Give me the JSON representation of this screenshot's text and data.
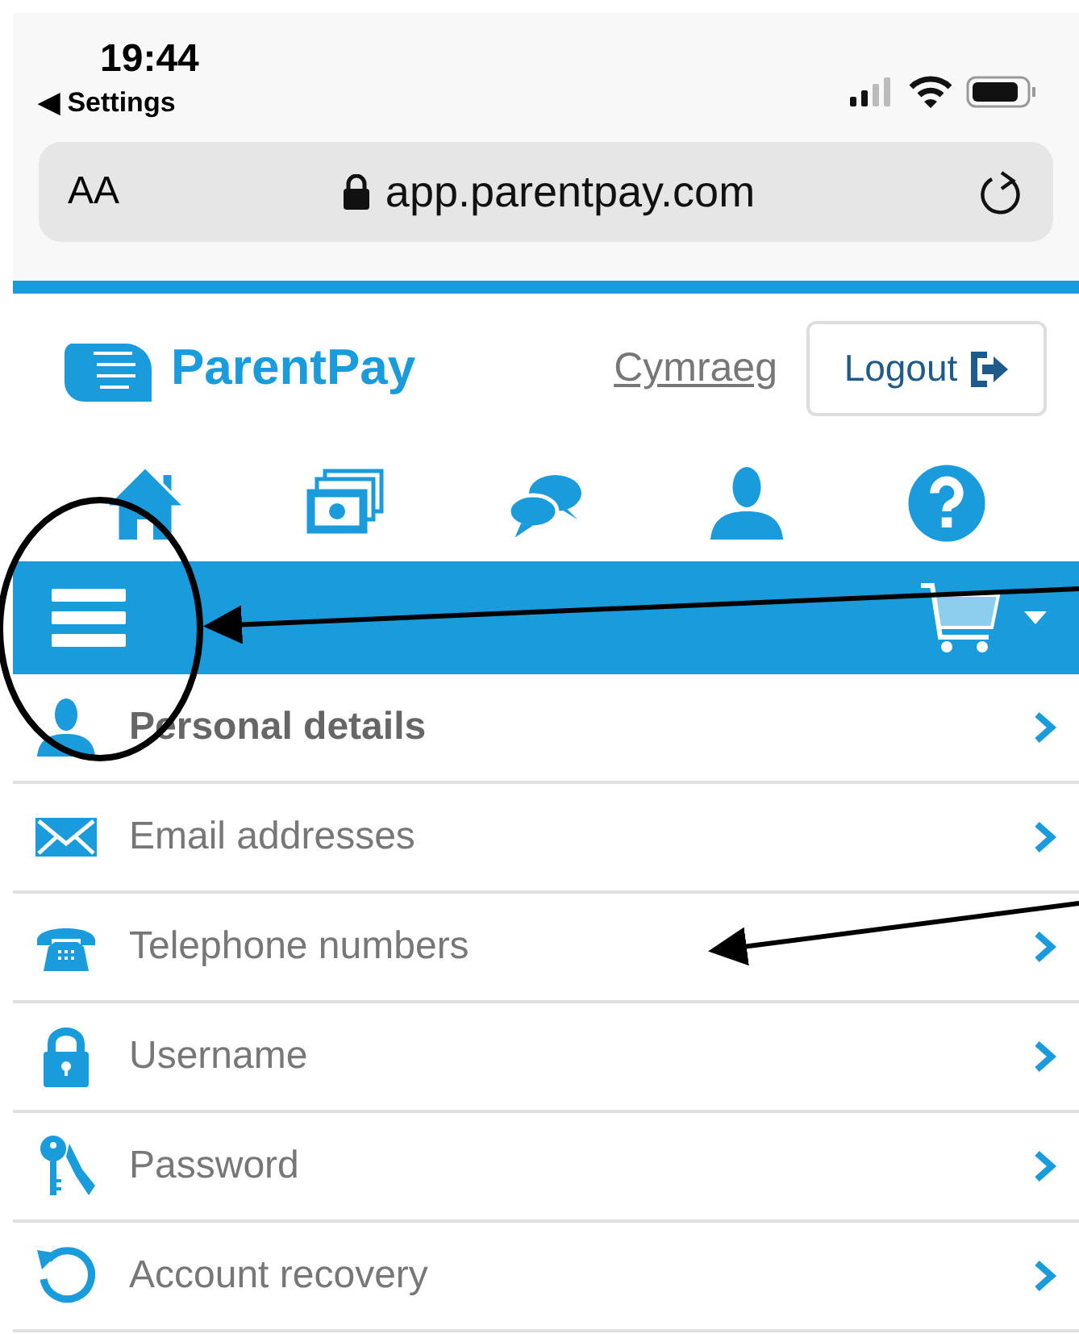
{
  "status_bar": {
    "time": "19:44",
    "back_label": "◀ Settings"
  },
  "address_bar": {
    "text_size": "AA",
    "url": "app.parentpay.com"
  },
  "header": {
    "logo_text": "ParentPay",
    "language_link": "Cymraeg",
    "logout_label": "Logout"
  },
  "nav_icons": [
    {
      "kind": "home"
    },
    {
      "kind": "money"
    },
    {
      "kind": "chat"
    },
    {
      "kind": "user"
    },
    {
      "kind": "help"
    }
  ],
  "menu": [
    {
      "label": "Personal details",
      "kind": "user",
      "selected": true
    },
    {
      "label": "Email addresses",
      "kind": "email",
      "selected": false
    },
    {
      "label": "Telephone numbers",
      "kind": "phone",
      "selected": false
    },
    {
      "label": "Username",
      "kind": "lock",
      "selected": false
    },
    {
      "label": "Password",
      "kind": "key",
      "selected": false
    },
    {
      "label": "Account recovery",
      "kind": "recovery",
      "selected": false
    }
  ]
}
